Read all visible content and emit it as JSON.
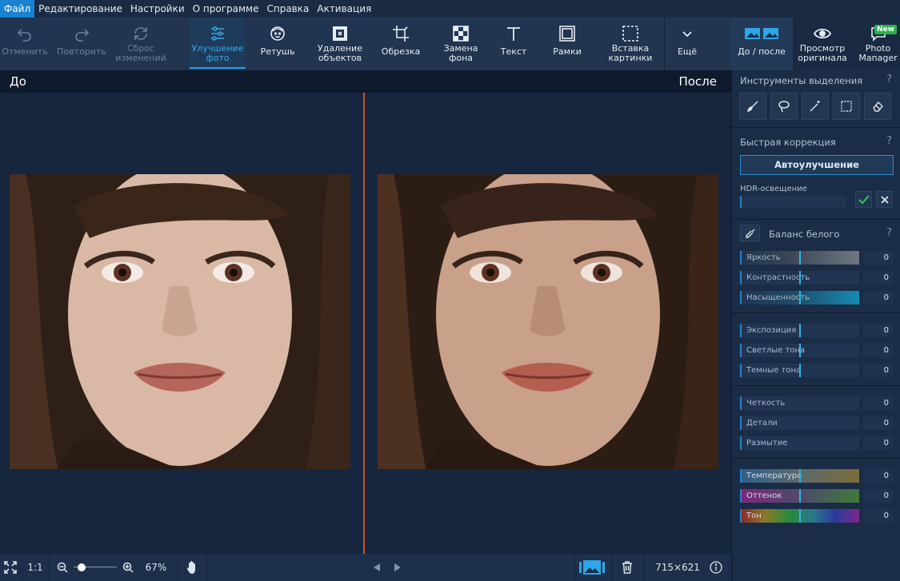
{
  "menu": [
    "Файл",
    "Редактирование",
    "Настройки",
    "О программе",
    "Справка",
    "Активация"
  ],
  "toolbar": {
    "undo": "Отменить",
    "redo": "Повторить",
    "reset_1": "Сброс",
    "reset_2": "изменений",
    "enhance_1": "Улучшение",
    "enhance_2": "фото",
    "retouch": "Ретушь",
    "remove_1": "Удаление",
    "remove_2": "объектов",
    "crop": "Обрезка",
    "bg_1": "Замена",
    "bg_2": "фона",
    "text": "Текст",
    "frames": "Рамки",
    "insert_1": "Вставка",
    "insert_2": "картинки",
    "more": "Ещё",
    "before_after": "До / после",
    "view_1": "Просмотр",
    "view_2": "оригинала",
    "pm_1": "Photo",
    "pm_2": "Manager",
    "new_badge": "New"
  },
  "canvas": {
    "before_label": "До",
    "after_label": "После"
  },
  "status": {
    "zoom_ratio": "1:1",
    "zoom_percent": "67%",
    "zoom_level": 0.12,
    "dimensions": "715×621"
  },
  "panel": {
    "selection_title": "Инструменты выделения",
    "quick_title": "Быстрая коррекция",
    "auto_button": "Автоулучшение",
    "hdr_label": "HDR-освещение",
    "wb_label": "Баланс белого",
    "help": "?",
    "sliders_a": [
      {
        "label": "Яркость",
        "value": "0"
      },
      {
        "label": "Контрастность",
        "value": "0"
      },
      {
        "label": "Насыщенность",
        "value": "0"
      }
    ],
    "sliders_b": [
      {
        "label": "Экспозиция",
        "value": "0"
      },
      {
        "label": "Светлые тона",
        "value": "0"
      },
      {
        "label": "Темные тона",
        "value": "0"
      }
    ],
    "sliders_c": [
      {
        "label": "Четкость",
        "value": "0"
      },
      {
        "label": "Детали",
        "value": "0"
      },
      {
        "label": "Размытие",
        "value": "0"
      }
    ],
    "sliders_d": [
      {
        "label": "Температура",
        "value": "0"
      },
      {
        "label": "Оттенок",
        "value": "0"
      },
      {
        "label": "Тон",
        "value": "0"
      }
    ]
  },
  "colors": {
    "accent": "#1a82d0",
    "divider": "#c9532c",
    "badge": "#2bb24c"
  }
}
